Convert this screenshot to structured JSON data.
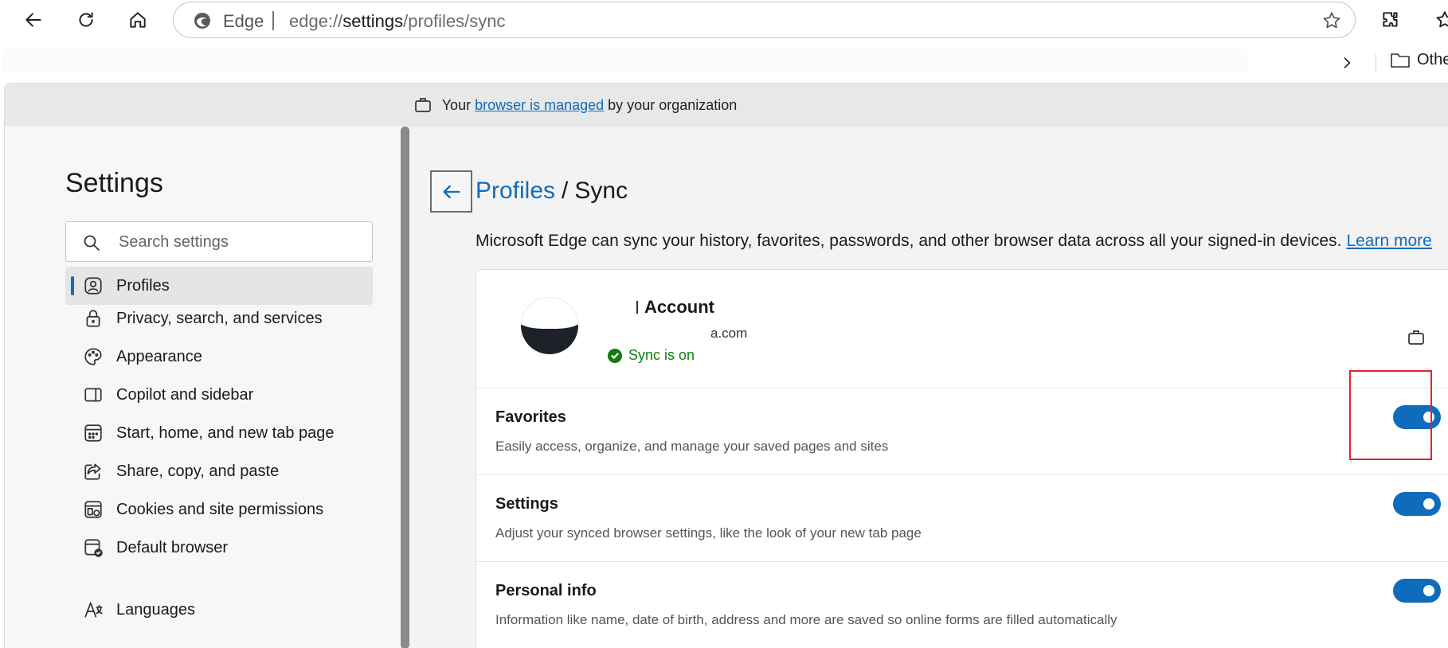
{
  "browser": {
    "brand": "Edge",
    "url_prefix": "edge://",
    "url_host": "settings",
    "url_path": "/profiles/sync",
    "favorites_other": "Othe"
  },
  "banner": {
    "text_before": "Your",
    "link": "browser is managed",
    "text_after": "by your organization"
  },
  "nav": {
    "title": "Settings",
    "search_placeholder": "Search settings",
    "items": [
      {
        "label": "Profiles",
        "icon": "profile-icon",
        "active": true
      },
      {
        "label": "Privacy, search, and services",
        "icon": "lock-icon"
      },
      {
        "label": "Appearance",
        "icon": "palette-icon"
      },
      {
        "label": "Copilot and sidebar",
        "icon": "sidebar-icon"
      },
      {
        "label": "Start, home, and new tab page",
        "icon": "home-grid-icon"
      },
      {
        "label": "Share, copy, and paste",
        "icon": "share-icon"
      },
      {
        "label": "Cookies and site permissions",
        "icon": "cookie-icon"
      },
      {
        "label": "Default browser",
        "icon": "browser-check-icon"
      },
      {
        "label": "Languages",
        "icon": "language-icon"
      }
    ]
  },
  "main": {
    "breadcrumb_parent": "Profiles",
    "breadcrumb_separator": "/",
    "breadcrumb_current": "Sync",
    "description": "Microsoft Edge can sync your history, favorites, passwords, and other browser data across all your signed-in devices.",
    "learn_more": "Learn more",
    "account": {
      "name": "Account",
      "email": "a.com",
      "sync_status": "Sync is on"
    },
    "sync_items": [
      {
        "title": "Favorites",
        "subtitle": "Easily access, organize, and manage your saved pages and sites",
        "enabled": true
      },
      {
        "title": "Settings",
        "subtitle": "Adjust your synced browser settings, like the look of your new tab page",
        "enabled": true
      },
      {
        "title": "Personal info",
        "subtitle": "Information like name, date of birth, address and more are saved so online forms are filled automatically",
        "enabled": true
      }
    ]
  },
  "colors": {
    "accent": "#0f6cbd",
    "success": "#107c10",
    "highlight": "#e0242b"
  }
}
